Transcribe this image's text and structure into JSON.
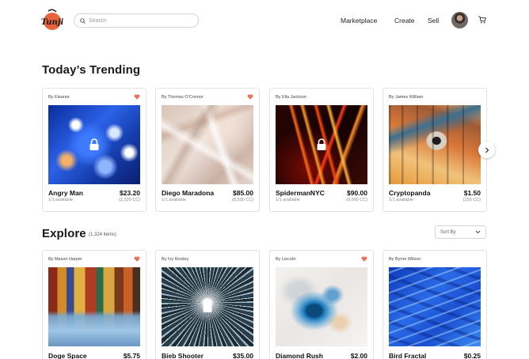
{
  "header": {
    "logo_text": "Tunji",
    "search": {
      "placeholder": "Search"
    },
    "nav": [
      {
        "label": "Marketplace"
      },
      {
        "label": "Create"
      },
      {
        "label": "Sell"
      }
    ],
    "icons": {
      "search": "search-icon",
      "cart": "cart-icon",
      "avatar": "user-avatar"
    }
  },
  "trending": {
    "title": "Today’s Trending",
    "items": [
      {
        "by": "By Eleanor",
        "name": "Angry Man",
        "price": "$23.20",
        "available": "1/1 available",
        "cc": "(2,320 CC)",
        "liked": true,
        "locked": true
      },
      {
        "by": "By Thomas O’Connor",
        "name": "Diego Maradona",
        "price": "$85.00",
        "available": "1/1 available",
        "cc": "(8,500 CC)",
        "liked": true,
        "locked": false
      },
      {
        "by": "By Ella Jackson",
        "name": "SpidermanNYC",
        "price": "$90.00",
        "available": "1/1 available",
        "cc": "(9,000 CC)",
        "liked": false,
        "locked": true
      },
      {
        "by": "By James William",
        "name": "Cryptopanda",
        "price": "$1.50",
        "available": "1/1 available",
        "cc": "(150 CC)",
        "liked": false,
        "locked": false
      }
    ]
  },
  "explore": {
    "title": "Explore",
    "count": "(1,324 items)",
    "sort_label": "Sort By",
    "items": [
      {
        "by": "By Mason Harper",
        "name": "Doge Space",
        "price": "$5.75",
        "liked": true,
        "locked": false
      },
      {
        "by": "By Ivy Kinsley",
        "name": "Bieb Shooter",
        "price": "$35.00",
        "liked": false,
        "locked": true
      },
      {
        "by": "By Lincoln",
        "name": "Diamond Rush",
        "price": "$2.00",
        "liked": true,
        "locked": false
      },
      {
        "by": "By Byrne Wilson",
        "name": "Bird Fractal",
        "price": "$0.25",
        "liked": false,
        "locked": false
      }
    ]
  },
  "colors": {
    "accent": "#e8643f",
    "heart": "#e8735a",
    "text": "#1a1a1a"
  }
}
